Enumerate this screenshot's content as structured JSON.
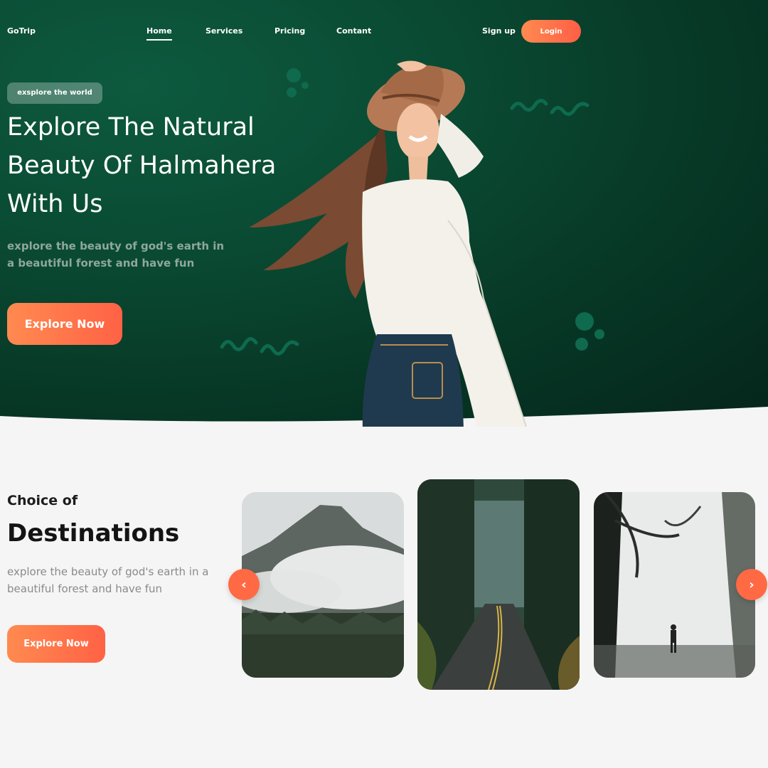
{
  "nav": {
    "brand": "GoTrip",
    "links": [
      "Home",
      "Services",
      "Pricing",
      "Contant"
    ],
    "signup": "Sign up",
    "login": "Login"
  },
  "hero": {
    "badge": "exsplore the world",
    "title": "Explore The Natural Beauty Of Halmahera With Us",
    "subtitle": "explore the beauty of god's earth in a beautiful forest and have fun",
    "cta": "Explore Now"
  },
  "destinations": {
    "kicker": "Choice of",
    "title": "Destinations",
    "subtitle": "explore the beauty of god's earth in a beautiful forest and have fun",
    "cta": "Explore Now",
    "prev_icon": "chevron-left-icon",
    "next_icon": "chevron-right-icon"
  },
  "colors": {
    "accent": "#ff6a45",
    "hero_green": "#0a4a33",
    "background": "#f5f5f5"
  }
}
